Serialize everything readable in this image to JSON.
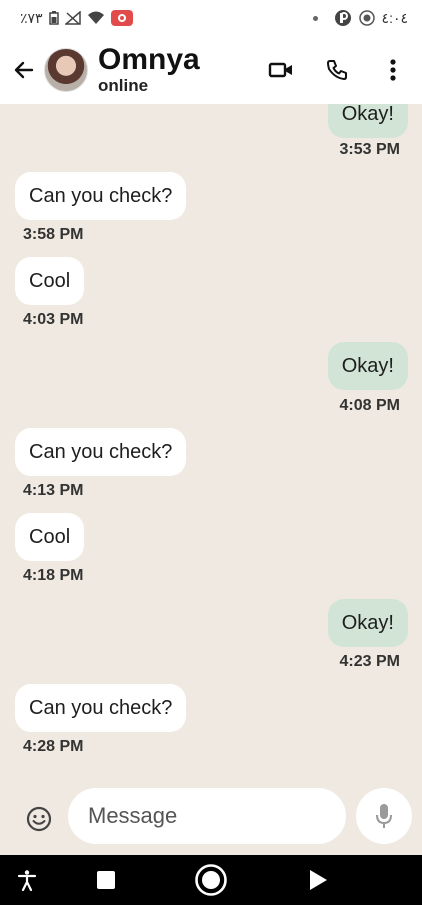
{
  "status_bar": {
    "left_text": "٪٧٣",
    "time": "٤:٠٤"
  },
  "header": {
    "contact_name": "Omnya",
    "contact_status": "online"
  },
  "messages": [
    {
      "direction": "out",
      "text": "Okay!",
      "time": "3:53 PM"
    },
    {
      "direction": "in",
      "text": "Can you check?",
      "time": "3:58 PM"
    },
    {
      "direction": "in",
      "text": "Cool",
      "time": "4:03 PM"
    },
    {
      "direction": "out",
      "text": "Okay!",
      "time": "4:08 PM"
    },
    {
      "direction": "in",
      "text": "Can you check?",
      "time": "4:13 PM"
    },
    {
      "direction": "in",
      "text": "Cool",
      "time": "4:18 PM"
    },
    {
      "direction": "out",
      "text": "Okay!",
      "time": "4:23 PM"
    },
    {
      "direction": "in",
      "text": "Can you check?",
      "time": "4:28 PM"
    }
  ],
  "input": {
    "placeholder": "Message"
  },
  "icons": {
    "back": "arrow-left-icon",
    "video": "video-camera-icon",
    "call": "phone-icon",
    "menu": "more-vertical-icon",
    "emoji": "emoji-icon",
    "mic": "microphone-icon"
  },
  "colors": {
    "chat_background": "#efe9e1",
    "outgoing_bubble": "#d1e4d6",
    "incoming_bubble": "#ffffff"
  }
}
